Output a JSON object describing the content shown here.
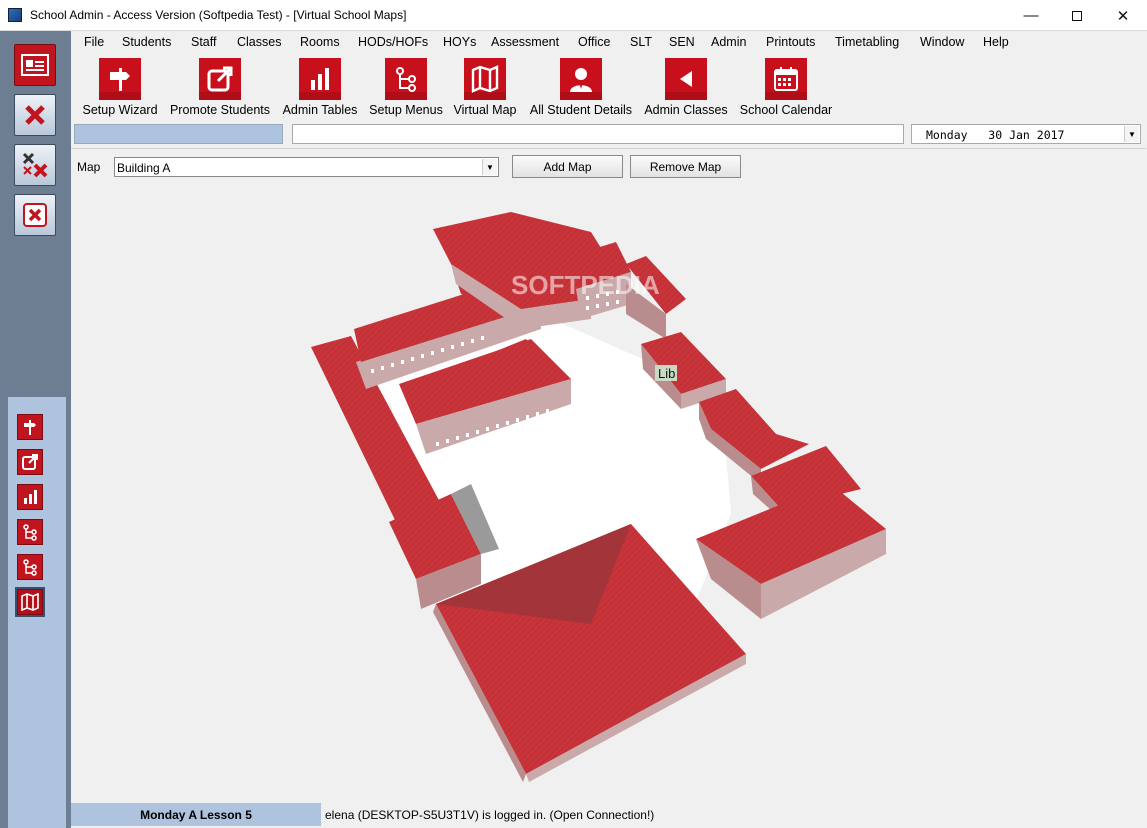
{
  "window": {
    "title": "School Admin - Access Version (Softpedia Test) - [Virtual School Maps]"
  },
  "menu": [
    "File",
    "Students",
    "Staff",
    "Classes",
    "Rooms",
    "HODs/HOFs",
    "HOYs",
    "Assessment",
    "Office",
    "SLT",
    "SEN",
    "Admin",
    "Printouts",
    "Timetabling",
    "Window",
    "Help"
  ],
  "toolbar": [
    {
      "label": "Setup Wizard",
      "icon": "signpost-icon"
    },
    {
      "label": "Promote Students",
      "icon": "external-link-icon"
    },
    {
      "label": "Admin Tables",
      "icon": "bar-chart-icon"
    },
    {
      "label": "Setup Menus",
      "icon": "flow-icon"
    },
    {
      "label": "Virtual Map",
      "icon": "map-icon"
    },
    {
      "label": "All Student Details",
      "icon": "student-icon"
    },
    {
      "label": "Admin Classes",
      "icon": "back-arrow-icon"
    },
    {
      "label": "School Calendar",
      "icon": "calendar-icon"
    }
  ],
  "date_field": "Monday   30 Jan 2017",
  "map": {
    "label": "Map",
    "selected": "Building A",
    "add_button": "Add Map",
    "remove_button": "Remove Map",
    "room_label": "Lib"
  },
  "watermark": "SOFTPEDIA",
  "footer": {
    "lesson": "Monday A Lesson 5",
    "status": "elena (DESKTOP-S5U3T1V) is logged in. (Open Connection!)"
  },
  "colors": {
    "roof": "#c8343a",
    "accent_red": "#c8101d",
    "rail": "#6d7e93",
    "rail_light": "#aec3dd"
  }
}
